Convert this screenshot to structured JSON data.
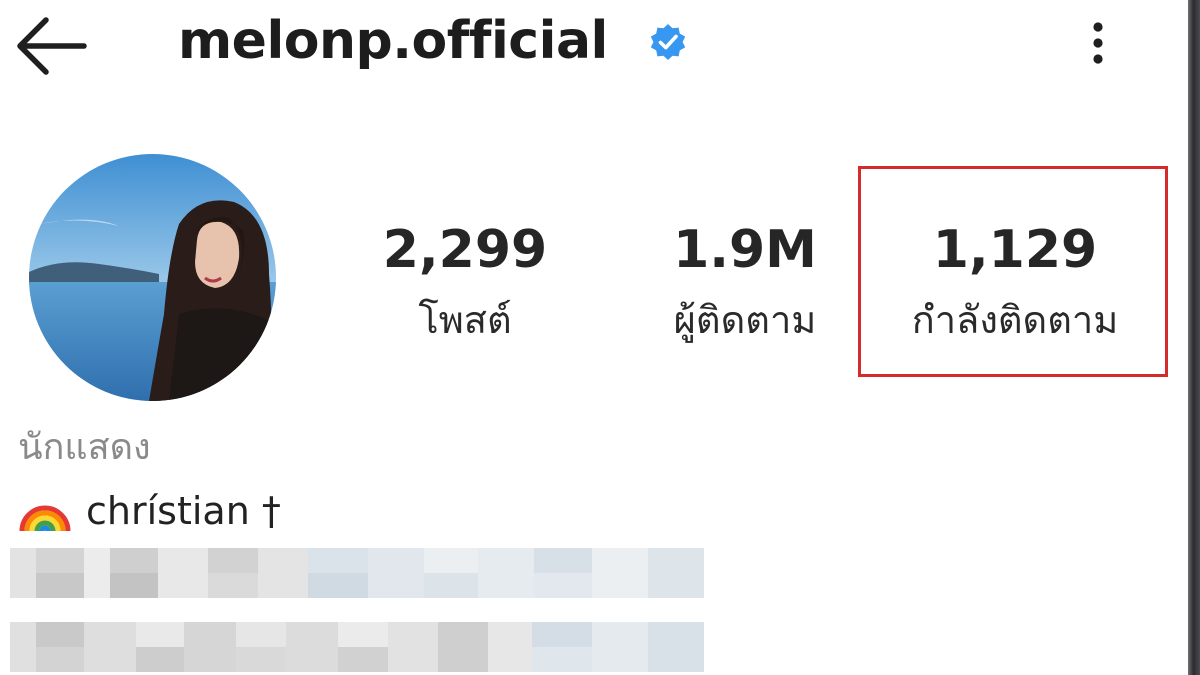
{
  "header": {
    "username": "melonp.official",
    "verified": true,
    "back_icon": "arrow-left-icon",
    "more_icon": "more-vertical-icon"
  },
  "stats": {
    "posts": {
      "value": "2,299",
      "label": "โพสต์"
    },
    "followers": {
      "value": "1.9M",
      "label": "ผู้ติดตาม"
    },
    "following": {
      "value": "1,129",
      "label": "กำลังติดตาม"
    }
  },
  "bio": {
    "category": "นักแสดง",
    "line1_emoji": "rainbow-icon",
    "line1_text": "chrístian †"
  },
  "colors": {
    "highlight_border": "#d62b2b",
    "verified_badge": "#3897f0",
    "category_text": "#8a8a8a"
  }
}
